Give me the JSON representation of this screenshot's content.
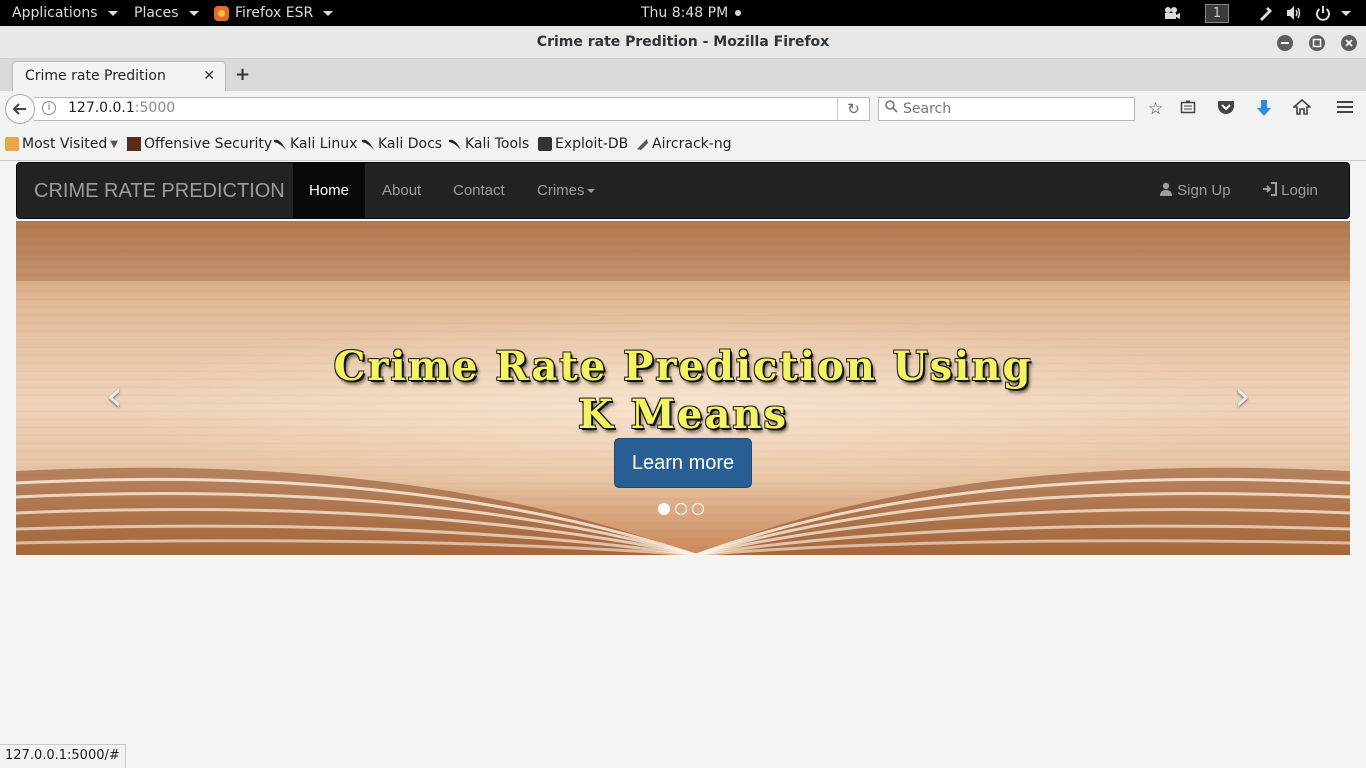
{
  "gnome": {
    "applications": "Applications",
    "places": "Places",
    "firefox": "Firefox ESR",
    "clock": "Thu  8:48 PM",
    "workspace": "1"
  },
  "window": {
    "title": "Crime rate Predition - Mozilla Firefox"
  },
  "tabs": [
    {
      "label": "Crime rate Predition"
    }
  ],
  "nav": {
    "url_host": "127.0.0.1",
    "url_port": ":5000",
    "search_placeholder": "Search"
  },
  "bookmarks": [
    {
      "label": "Most Visited",
      "icon": "most-visited-icon"
    },
    {
      "label": "Offensive Security",
      "icon": "offensive-security-icon"
    },
    {
      "label": "Kali Linux",
      "icon": "kali-icon"
    },
    {
      "label": "Kali Docs",
      "icon": "kali-icon"
    },
    {
      "label": "Kali Tools",
      "icon": "kali-icon"
    },
    {
      "label": "Exploit-DB",
      "icon": "exploit-db-icon"
    },
    {
      "label": "Aircrack-ng",
      "icon": "aircrack-icon"
    }
  ],
  "site": {
    "brand": "CRIME RATE PREDICTION",
    "links": [
      "Home",
      "About",
      "Contact",
      "Crimes"
    ],
    "signup": "Sign Up",
    "login": "Login",
    "active_link": "Home",
    "navbar_color": "#222222"
  },
  "carousel": {
    "title_line1": "Crime Rate Prediction Using",
    "title_line2": "K Means",
    "button": "Learn more",
    "slides": 3,
    "active_slide": 1,
    "button_color": "#2a5f95",
    "title_color": "#f4f462"
  },
  "status": {
    "text": "127.0.0.1:5000/#"
  }
}
